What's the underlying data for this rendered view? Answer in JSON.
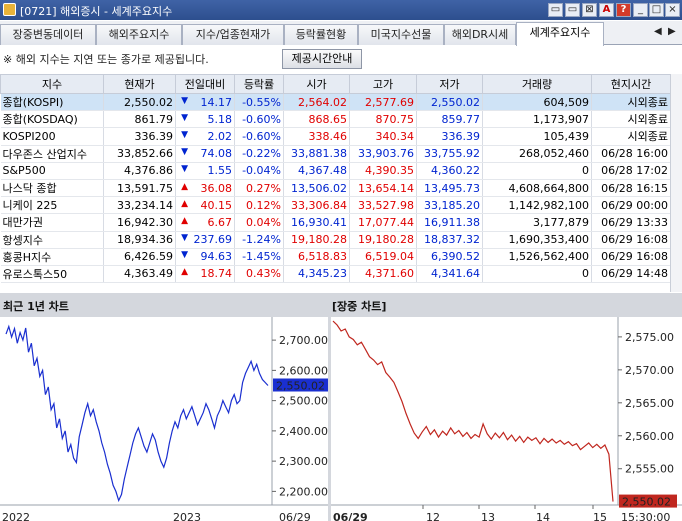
{
  "window": {
    "title": "[0721] 해외증시 - 세계주요지수",
    "buttons": [
      "▭",
      "▭",
      "⊠",
      "A",
      "?",
      "_",
      "□",
      "×"
    ]
  },
  "tabs": [
    {
      "label": "장중변동데이터"
    },
    {
      "label": "해외주요지수"
    },
    {
      "label": "지수/업종현재가"
    },
    {
      "label": "등락률현황"
    },
    {
      "label": "미국지수선물"
    },
    {
      "label": "해외DR시세"
    },
    {
      "label": "세계주요지수",
      "active": true
    }
  ],
  "notice": {
    "text": "※ 해외 지수는 지연 또는 종가로 제공됩니다.",
    "button": "제공시간안내"
  },
  "table": {
    "headers": [
      "지수",
      "현재가",
      "전일대비",
      "등락률",
      "시가",
      "고가",
      "저가",
      "거래량",
      "현지시간"
    ],
    "rows": [
      {
        "name": "종합(KOSPI)",
        "price": "2,550.02",
        "dir": "down",
        "change": "14.17",
        "rate": "-0.55%",
        "open": "2,564.02",
        "high": "2,577.69",
        "low": "2,550.02",
        "volume": "604,509",
        "time": "시외종료",
        "openc": "up",
        "highc": "up",
        "lowc": "dn"
      },
      {
        "name": "종합(KOSDAQ)",
        "price": "861.79",
        "dir": "down",
        "change": "5.18",
        "rate": "-0.60%",
        "open": "868.65",
        "high": "870.75",
        "low": "859.77",
        "volume": "1,173,907",
        "time": "시외종료",
        "openc": "up",
        "highc": "up",
        "lowc": "dn"
      },
      {
        "name": "KOSPI200",
        "price": "336.39",
        "dir": "down",
        "change": "2.02",
        "rate": "-0.60%",
        "open": "338.46",
        "high": "340.34",
        "low": "336.39",
        "volume": "105,439",
        "time": "시외종료",
        "openc": "up",
        "highc": "up",
        "lowc": "dn"
      },
      {
        "name": "다우존스 산업지수",
        "price": "33,852.66",
        "dir": "down",
        "change": "74.08",
        "rate": "-0.22%",
        "open": "33,881.38",
        "high": "33,903.76",
        "low": "33,755.92",
        "volume": "268,052,460",
        "time": "06/28 16:00",
        "openc": "dn",
        "highc": "dn",
        "lowc": "dn"
      },
      {
        "name": "S&P500",
        "price": "4,376.86",
        "dir": "down",
        "change": "1.55",
        "rate": "-0.04%",
        "open": "4,367.48",
        "high": "4,390.35",
        "low": "4,360.22",
        "volume": "0",
        "time": "06/28 17:02",
        "openc": "dn",
        "highc": "up",
        "lowc": "dn"
      },
      {
        "name": "나스닥 종합",
        "price": "13,591.75",
        "dir": "up",
        "change": "36.08",
        "rate": "0.27%",
        "open": "13,506.02",
        "high": "13,654.14",
        "low": "13,495.73",
        "volume": "4,608,664,800",
        "time": "06/28 16:15",
        "openc": "dn",
        "highc": "up",
        "lowc": "dn"
      },
      {
        "name": "니케이 225",
        "price": "33,234.14",
        "dir": "up",
        "change": "40.15",
        "rate": "0.12%",
        "open": "33,306.84",
        "high": "33,527.98",
        "low": "33,185.20",
        "volume": "1,142,982,100",
        "time": "06/29 00:00",
        "openc": "up",
        "highc": "up",
        "lowc": "dn"
      },
      {
        "name": "대만가권",
        "price": "16,942.30",
        "dir": "up",
        "change": "6.67",
        "rate": "0.04%",
        "open": "16,930.41",
        "high": "17,077.44",
        "low": "16,911.38",
        "volume": "3,177,879",
        "time": "06/29 13:33",
        "openc": "dn",
        "highc": "up",
        "lowc": "dn"
      },
      {
        "name": "항셍지수",
        "price": "18,934.36",
        "dir": "down",
        "change": "237.69",
        "rate": "-1.24%",
        "open": "19,180.28",
        "high": "19,180.28",
        "low": "18,837.32",
        "volume": "1,690,353,400",
        "time": "06/29 16:08",
        "openc": "up",
        "highc": "up",
        "lowc": "dn"
      },
      {
        "name": "홍콩H지수",
        "price": "6,426.59",
        "dir": "down",
        "change": "94.63",
        "rate": "-1.45%",
        "open": "6,518.83",
        "high": "6,519.04",
        "low": "6,390.52",
        "volume": "1,526,562,400",
        "time": "06/29 16:08",
        "openc": "up",
        "highc": "up",
        "lowc": "dn"
      },
      {
        "name": "유로스톡스50",
        "price": "4,363.49",
        "dir": "up",
        "change": "18.74",
        "rate": "0.43%",
        "open": "4,345.23",
        "high": "4,371.60",
        "low": "4,341.64",
        "volume": "0",
        "time": "06/29 14:48",
        "openc": "dn",
        "highc": "up",
        "lowc": "dn"
      }
    ]
  },
  "chart_data": [
    {
      "type": "line",
      "title": "최근 1년 차트",
      "color": "#1a2fd0",
      "x_ticks": [
        "2022",
        "2023",
        "06/29"
      ],
      "y_ticks": [
        "2,200.00",
        "2,300.00",
        "2,400.00",
        "2,500.00",
        "2,600.00",
        "2,700.00"
      ],
      "ylim": [
        2155,
        2750
      ],
      "current_label": "2,550.02",
      "values": [
        2720,
        2745,
        2710,
        2738,
        2690,
        2725,
        2700,
        2740,
        2660,
        2690,
        2615,
        2640,
        2580,
        2600,
        2520,
        2545,
        2470,
        2490,
        2410,
        2440,
        2375,
        2400,
        2330,
        2355,
        2310,
        2295,
        2380,
        2420,
        2460,
        2490,
        2450,
        2470,
        2430,
        2400,
        2360,
        2330,
        2290,
        2260,
        2220,
        2200,
        2170,
        2190,
        2240,
        2280,
        2320,
        2360,
        2390,
        2410,
        2380,
        2350,
        2330,
        2360,
        2390,
        2370,
        2330,
        2300,
        2280,
        2310,
        2360,
        2400,
        2430,
        2410,
        2450,
        2470,
        2440,
        2460,
        2480,
        2450,
        2420,
        2440,
        2460,
        2490,
        2470,
        2440,
        2410,
        2450,
        2470,
        2500,
        2480,
        2460,
        2500,
        2520,
        2490,
        2500,
        2560,
        2590,
        2610,
        2630,
        2600,
        2620,
        2590,
        2570,
        2560,
        2550
      ]
    },
    {
      "type": "line",
      "title": "[장중 차트]",
      "color": "#c0271f",
      "x_ticks": [
        "06/29",
        "12",
        "13",
        "14",
        "15",
        "15:30:00"
      ],
      "y_ticks": [
        "2,555.00",
        "2,560.00",
        "2,565.00",
        "2,570.00",
        "2,575.00"
      ],
      "ylim": [
        2549.5,
        2576.5
      ],
      "current_label": "2,550.02",
      "values": [
        2577.4,
        2576.8,
        2575.9,
        2576.2,
        2575.0,
        2574.6,
        2573.8,
        2574.2,
        2573.1,
        2572.0,
        2571.5,
        2570.8,
        2571.2,
        2569.6,
        2568.9,
        2568.1,
        2566.7,
        2565.2,
        2563.4,
        2561.8,
        2560.4,
        2559.6,
        2560.6,
        2561.4,
        2560.2,
        2560.9,
        2559.8,
        2560.7,
        2560.1,
        2561.2,
        2560.3,
        2560.8,
        2559.9,
        2560.5,
        2559.6,
        2560.2,
        2559.8,
        2561.8,
        2560.3,
        2559.5,
        2560.4,
        2559.7,
        2560.5,
        2559.4,
        2560.1,
        2559.2,
        2559.9,
        2559.0,
        2559.8,
        2559.3,
        2559.7,
        2558.8,
        2559.6,
        2559.0,
        2559.5,
        2558.9,
        2559.3,
        2558.7,
        2559.1,
        2558.5,
        2558.8,
        2557.9,
        2558.4,
        2558.9,
        2558.2,
        2558.7,
        2558.1,
        2558.6,
        2557.2,
        2550.02
      ]
    }
  ]
}
